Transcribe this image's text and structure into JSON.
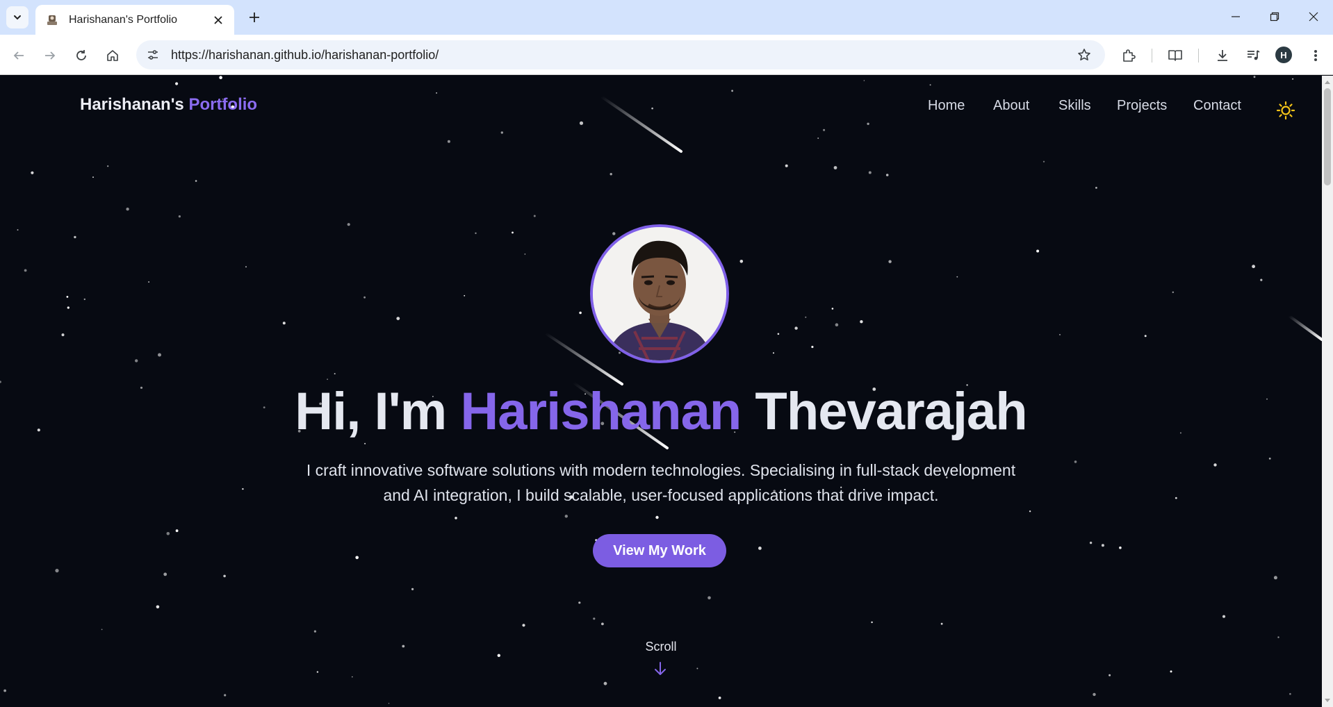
{
  "browser": {
    "tab_title": "Harishanan's Portfolio",
    "url": "https://harishanan.github.io/harishanan-portfolio/",
    "profile_initial": "H",
    "icons": [
      "tab-search-icon",
      "favicon-icon",
      "close-icon",
      "new-tab-icon",
      "minimize-icon",
      "restore-icon",
      "window-close-icon",
      "back-icon",
      "forward-icon",
      "reload-icon",
      "home-icon",
      "site-info-icon",
      "bookmark-star-icon",
      "extensions-icon",
      "reading-mode-icon",
      "downloads-icon",
      "media-control-icon",
      "more-menu-icon"
    ]
  },
  "site": {
    "brand": {
      "prefix": "Harishanan's",
      "accent": "Portfolio"
    },
    "nav": [
      {
        "label": "Home"
      },
      {
        "label": "About"
      },
      {
        "label": "Skills"
      },
      {
        "label": "Projects"
      },
      {
        "label": "Contact"
      }
    ],
    "theme_toggle_icon": "sun-icon",
    "hero": {
      "greeting": "Hi, I'm",
      "first_name": "Harishanan",
      "last_name": "Thevarajah",
      "subtitle": "I craft innovative software solutions with modern technologies. Specialising in full-stack development and AI integration, I build scalable, user-focused applications that drive impact.",
      "cta_label": "View My Work",
      "scroll_label": "Scroll"
    }
  },
  "colors": {
    "background": "#070a12",
    "accent": "#8566ea",
    "button": "#7c5de2",
    "sun": "#f5c518",
    "chrome_tabbar": "#d3e3fd"
  }
}
